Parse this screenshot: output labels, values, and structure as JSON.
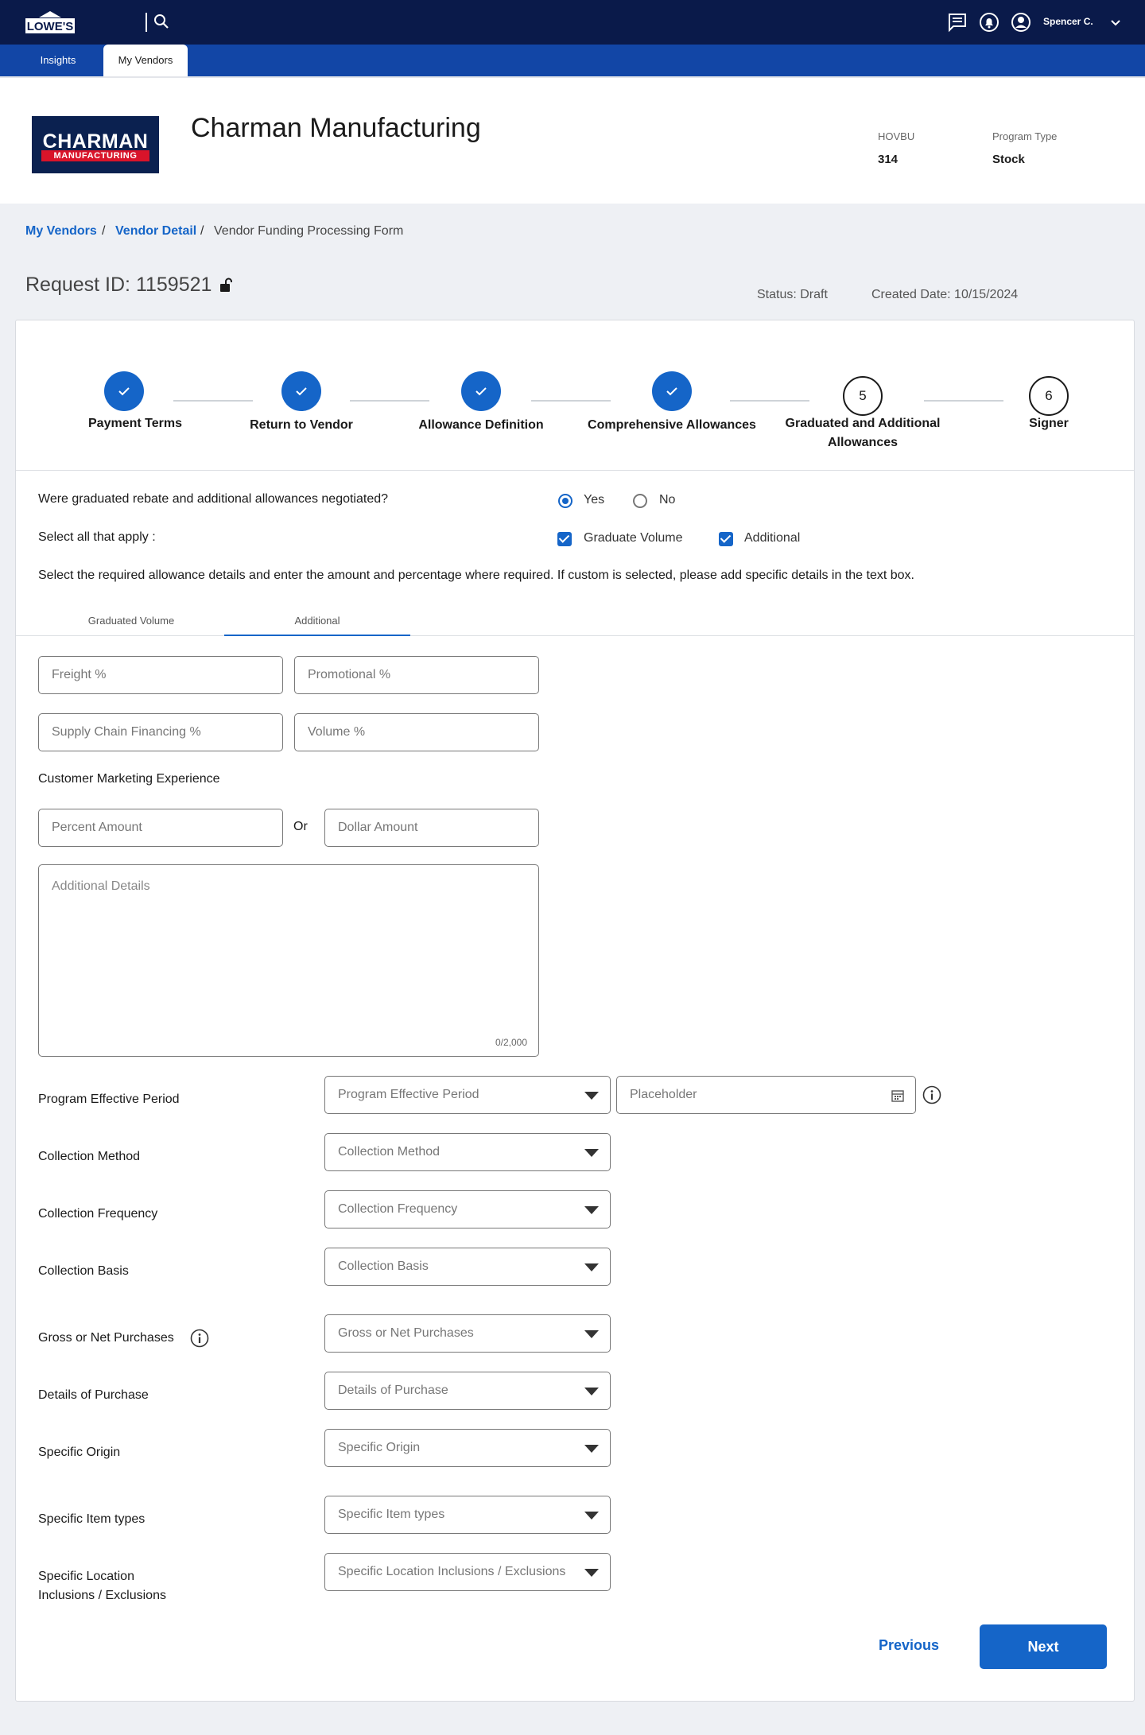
{
  "header": {
    "logo_text": "LOWE'S",
    "user_name": "Spencer C."
  },
  "nav": {
    "tabs": [
      {
        "label": "Insights"
      },
      {
        "label": "My Vendors"
      }
    ]
  },
  "vendor": {
    "logo_line1": "CHARMAN",
    "logo_line2": "MANUFACTURING",
    "name": "Charman Manufacturing",
    "hovbu_label": "HOVBU",
    "hovbu_value": "314",
    "program_type_label": "Program Type",
    "program_type_value": "Stock"
  },
  "breadcrumb": {
    "items": [
      "My Vendors",
      "Vendor Detail",
      "Vendor Funding Processing Form"
    ],
    "separator": "/"
  },
  "request": {
    "id_label": "Request ID: 1159521",
    "status": "Status:  Draft",
    "created": "Created Date: 10/15/2024"
  },
  "stepper": {
    "steps": [
      {
        "label": "Payment Terms",
        "done": true
      },
      {
        "label": "Return to Vendor",
        "done": true
      },
      {
        "label": "Allowance Definition",
        "done": true
      },
      {
        "label": "Comprehensive Allowances",
        "done": true
      },
      {
        "label": "Graduated and Additional Allowances",
        "number": "5",
        "done": false
      },
      {
        "label": "Signer",
        "number": "6",
        "done": false
      }
    ]
  },
  "form": {
    "q_negotiated": "Were graduated rebate and additional allowances negotiated?",
    "yes_label": "Yes",
    "no_label": "No",
    "q_select_all": "Select all that apply :",
    "graduate_volume_label": "Graduate Volume",
    "additional_label": "Additional",
    "instructions": "Select the required allowance details and enter the amount and percentage where required. If custom is selected, please add specific details in the text box.",
    "subtabs": [
      "Graduated Volume",
      "Additional"
    ],
    "freight_ph": "Freight %",
    "promotional_ph": "Promotional %",
    "supply_chain_ph": "Supply Chain Financing %",
    "volume_ph": "Volume %",
    "cme_label": "Customer Marketing Experience",
    "percent_amount_ph": "Percent Amount",
    "or_label": "Or",
    "dollar_amount_ph": "Dollar Amount",
    "additional_details_ph": "Additional Details",
    "char_count": "0/2,000",
    "fields": [
      {
        "label": "Program Effective Period",
        "placeholder": "Program Effective Period"
      },
      {
        "label": "Collection Method",
        "placeholder": "Collection Method"
      },
      {
        "label": "Collection Frequency",
        "placeholder": "Collection Frequency"
      },
      {
        "label": "Collection Basis",
        "placeholder": "Collection Basis"
      },
      {
        "label": "Gross or Net Purchases",
        "placeholder": "Gross or Net Purchases"
      },
      {
        "label": "Details of Purchase",
        "placeholder": "Details of Purchase"
      },
      {
        "label": "Specific Origin",
        "placeholder": "Specific Origin"
      },
      {
        "label": "Specific Item types",
        "placeholder": "Specific Item types"
      },
      {
        "label": "Specific Location Inclusions / Exclusions",
        "placeholder": "Specific Location Inclusions / Exclusions"
      }
    ],
    "date_placeholder": "Placeholder",
    "previous_label": "Previous",
    "next_label": "Next"
  },
  "colors": {
    "navy": "#0a1a4a",
    "nav_blue": "#1246a6",
    "accent": "#1565c8"
  }
}
